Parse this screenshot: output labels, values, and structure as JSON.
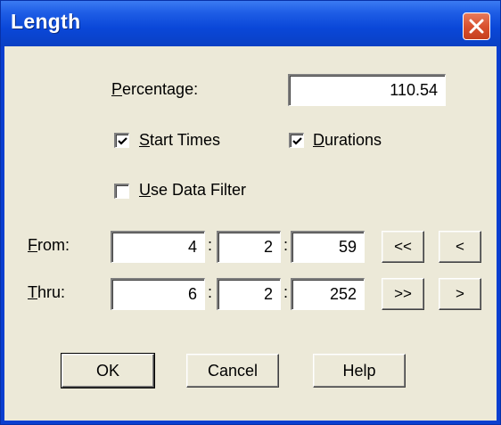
{
  "window": {
    "title": "Length"
  },
  "percentage": {
    "label_pre": "",
    "label_u": "P",
    "label_post": "ercentage:",
    "value": "110.54"
  },
  "checkboxes": {
    "start_times": {
      "u": "S",
      "rest": "tart Times",
      "checked": true
    },
    "durations": {
      "u": "D",
      "rest": "urations",
      "checked": true
    },
    "use_data_filter": {
      "u": "U",
      "rest": "se Data Filter",
      "checked": false
    }
  },
  "from": {
    "u": "F",
    "rest": "rom:",
    "bar": "4",
    "beat": "2",
    "tick": "59",
    "btn_first": "<<",
    "btn_prev": "<"
  },
  "thru": {
    "u": "T",
    "rest": "hru:",
    "bar": "6",
    "beat": "2",
    "tick": "252",
    "btn_last": ">>",
    "btn_next": ">"
  },
  "separator": ":",
  "buttons": {
    "ok": "OK",
    "cancel": "Cancel",
    "help": "Help"
  },
  "colors": {
    "titlebar": "#0a47d8",
    "client_bg": "#ece9d8",
    "close_button": "#d9512f"
  },
  "icons": {
    "close": "close-icon",
    "check": "checkmark-icon"
  }
}
